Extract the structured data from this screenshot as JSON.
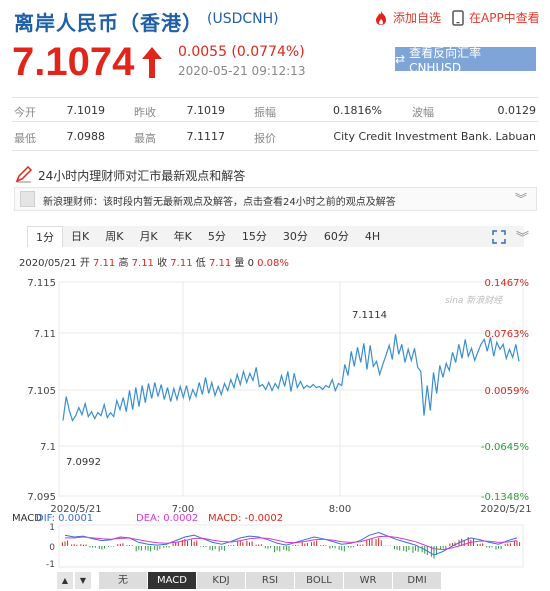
{
  "header": {
    "title": "离岸人民币（香港）",
    "code": "(USDCNH)",
    "add_watch": "添加自选",
    "open_app": "在APP中查看"
  },
  "quote": {
    "price": "7.1074",
    "change": "0.0055 (0.0774%)",
    "datetime": "2020-05-21 09:12:13",
    "reverse_button": "查看反向汇率 CNHUSD"
  },
  "stats": [
    {
      "label": "今开",
      "value": "7.1019"
    },
    {
      "label": "昨收",
      "value": "7.1019"
    },
    {
      "label": "振幅",
      "value": "0.1816%"
    },
    {
      "label": "波幅",
      "value": "0.0129"
    },
    {
      "label": "最低",
      "value": "7.0988"
    },
    {
      "label": "最高",
      "value": "7.1117"
    },
    {
      "label": "报价",
      "value": "City Credit Investment Bank. Labuan"
    }
  ],
  "notice": {
    "title": "24小时内理财师对汇市最新观点和解答",
    "comment": "新浪理财师：该时段内暂无最新观点及解答，点击查看24小时之前的观点及解答"
  },
  "tabs": [
    "1分",
    "日K",
    "周K",
    "月K",
    "年K",
    "5分",
    "15分",
    "30分",
    "60分",
    "4H"
  ],
  "info_bar": {
    "date": "2020/05/21",
    "open_label": "开",
    "open": "7.11",
    "high_label": "高",
    "high": "7.11",
    "close_label": "收",
    "close": "7.11",
    "low_label": "低",
    "low": "7.11",
    "vol_label": "量",
    "vol": "0",
    "pct": "0.08%"
  },
  "watermark": "新浪财经",
  "chart_data": {
    "type": "line",
    "y_ticks": [
      "7.115",
      "7.11",
      "7.105",
      "7.1",
      "7.095"
    ],
    "y_values": [
      7.115,
      7.11,
      7.105,
      7.1,
      7.095
    ],
    "pct_ticks": [
      "0.1467%",
      "0.0763%",
      "0.0059%",
      "-0.0645%",
      "-0.1348%"
    ],
    "pct_colors": [
      "#e1251b",
      "#e1251b",
      "#e1251b",
      "#2a9d3c",
      "#2a9d3c"
    ],
    "x_labels": [
      "2020/5/21",
      "7:00",
      "8:00",
      "2020/5/21"
    ],
    "annot_high": "7.1114",
    "annot_low": "7.0992",
    "ylim": [
      7.095,
      7.1163
    ],
    "line_color": "#3a8fd0",
    "series": [
      {
        "values": [
          7.1025,
          7.1049,
          7.1035,
          7.1025,
          7.103,
          7.1038,
          7.1031,
          7.1042,
          7.1029,
          7.1034,
          7.1027,
          7.1033,
          7.103,
          7.1041,
          7.1028,
          7.1033,
          7.1029,
          7.1045,
          7.1036,
          7.1048,
          7.1034,
          7.1055,
          7.1036,
          7.1058,
          7.1039,
          7.106,
          7.1043,
          7.1062,
          7.1047,
          7.1063,
          7.1049,
          7.1061,
          7.1046,
          7.1058,
          7.1044,
          7.1057,
          7.1046,
          7.1059,
          7.1048,
          7.106,
          7.1046,
          7.1056,
          7.1049,
          7.1063,
          7.1051,
          7.1068,
          7.1052,
          7.1063,
          7.105,
          7.1059,
          7.1051,
          7.1062,
          7.1055,
          7.1066,
          7.1058,
          7.1071,
          7.1061,
          7.1074,
          7.1063,
          7.1072,
          7.1065,
          7.1078,
          7.1059,
          7.1061,
          7.1056,
          7.1063,
          7.1055,
          7.1062,
          7.1057,
          7.107,
          7.1059,
          7.1074,
          7.1054,
          7.1072,
          7.1058,
          7.1064,
          7.1057,
          7.106,
          7.1058,
          7.1061,
          7.1058,
          7.1059,
          7.1056,
          7.106,
          7.1058,
          7.1066,
          7.1055,
          7.1062,
          7.106,
          7.1081,
          7.107,
          7.1094,
          7.1079,
          7.1098,
          7.1083,
          7.1102,
          7.1076,
          7.11,
          7.1079,
          7.1084,
          7.1071,
          7.1081,
          7.109,
          7.11,
          7.1086,
          7.1111,
          7.1091,
          7.1101,
          7.1083,
          7.1096,
          7.1085,
          7.1097,
          7.1078,
          7.1074,
          7.103,
          7.106,
          7.1035,
          7.1073,
          7.1052,
          7.108,
          7.1068,
          7.1082,
          7.1075,
          7.1093,
          7.1083,
          7.1101,
          7.1087,
          7.1106,
          7.1089,
          7.1097,
          7.1085,
          7.1093,
          7.1101,
          7.1106,
          7.1094,
          7.1108,
          7.1089,
          7.1103,
          7.1096,
          7.1101,
          7.1087,
          7.1096,
          7.1088,
          7.1101,
          7.1084
        ]
      }
    ]
  },
  "macd": {
    "label": "MACD",
    "dif_label": "DIF: 0.0001",
    "dea_label": "DEA: 0.0002",
    "macd_label": "MACD: -0.0002",
    "ticks": [
      "1",
      "0",
      "-1"
    ],
    "dif_color": "#3a6fd8",
    "dea_color": "#d23ad8",
    "macd_color": "#e1251b",
    "dif": [
      0.6,
      0.5,
      0.55,
      0.4,
      0.3,
      0.35,
      0.5,
      0.45,
      0.2,
      0.1,
      0.05,
      0.1,
      0.3,
      0.5,
      0.6,
      0.4,
      0.2,
      0.1,
      0.25,
      0.45,
      0.55,
      0.5,
      0.35,
      0.15,
      0.05,
      0.2,
      0.35,
      0.5,
      0.4,
      0.25,
      0.1,
      0.15,
      0.3,
      0.6,
      0.75,
      0.55,
      0.35,
      0.2,
      0.05,
      -0.2,
      -0.5,
      -0.3,
      0.0,
      0.25,
      0.45,
      0.35,
      0.2,
      0.1,
      0.3,
      0.45
    ],
    "dea": [
      0.45,
      0.45,
      0.5,
      0.45,
      0.4,
      0.38,
      0.42,
      0.44,
      0.35,
      0.25,
      0.18,
      0.15,
      0.2,
      0.3,
      0.42,
      0.42,
      0.33,
      0.25,
      0.22,
      0.3,
      0.4,
      0.45,
      0.42,
      0.32,
      0.2,
      0.18,
      0.25,
      0.35,
      0.38,
      0.33,
      0.24,
      0.2,
      0.24,
      0.38,
      0.52,
      0.54,
      0.47,
      0.36,
      0.24,
      0.05,
      -0.15,
      -0.2,
      -0.1,
      0.05,
      0.2,
      0.28,
      0.26,
      0.2,
      0.22,
      0.3
    ],
    "hist": [
      0.3,
      0.1,
      0.1,
      -0.1,
      -0.2,
      -0.05,
      0.15,
      0.05,
      -0.3,
      -0.3,
      -0.25,
      -0.1,
      0.2,
      0.4,
      0.35,
      -0.05,
      -0.25,
      -0.3,
      0.05,
      0.3,
      0.3,
      0.1,
      -0.15,
      -0.35,
      -0.3,
      0.05,
      0.2,
      0.3,
      0.05,
      -0.15,
      -0.3,
      -0.1,
      0.1,
      0.45,
      0.45,
      0.02,
      -0.25,
      -0.32,
      -0.38,
      -0.5,
      -0.7,
      -0.2,
      0.2,
      0.4,
      0.5,
      0.15,
      -0.1,
      -0.2,
      0.15,
      0.3
    ]
  },
  "indicator_tabs": [
    "无",
    "MACD",
    "KDJ",
    "RSI",
    "BOLL",
    "WR",
    "DMI"
  ],
  "colors": {
    "up": "#e1251b",
    "down": "#2a9d3c",
    "brand": "#1f5fa8",
    "button": "#7fa5d8"
  }
}
